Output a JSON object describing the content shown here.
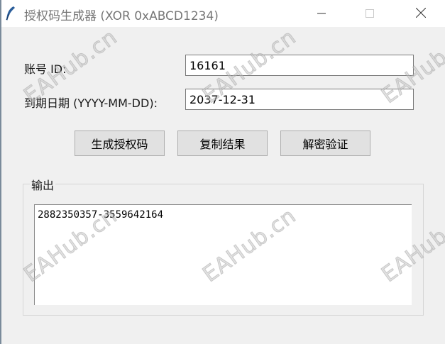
{
  "window": {
    "title": "授权码生成器 (XOR 0xABCD1234)"
  },
  "form": {
    "account_label": "账号 ID:",
    "account_value": "16161",
    "expiry_label": "到期日期 (YYYY-MM-DD):",
    "expiry_value": "2037-12-31"
  },
  "buttons": {
    "generate": "生成授权码",
    "copy": "复制结果",
    "verify": "解密验证"
  },
  "output": {
    "group_title": "输出",
    "text": "2882350357-3559642164"
  },
  "watermark": {
    "text": "EAHub.cn"
  },
  "icons": {
    "app": "feather-icon",
    "minimize": "minimize-icon",
    "maximize": "maximize-icon",
    "close": "close-icon"
  }
}
